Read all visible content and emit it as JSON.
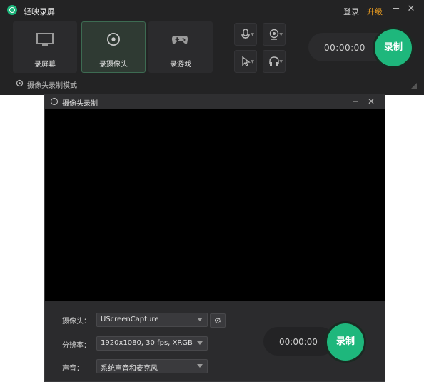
{
  "app": {
    "title": "轻映录屏",
    "login": "登录",
    "upgrade": "升级",
    "accent": "#1eb77c",
    "upgrade_color": "#f0a020"
  },
  "modes": [
    {
      "label": "录屏幕",
      "icon": "monitor-icon"
    },
    {
      "label": "录摄像头",
      "icon": "camera-lens-icon",
      "active": true
    },
    {
      "label": "录游戏",
      "icon": "gamepad-icon"
    }
  ],
  "tools": [
    "microphone-icon",
    "webcam-icon",
    "cursor-icon",
    "headphones-icon"
  ],
  "timer": "00:00:00",
  "record_label": "录制",
  "mode_info": "摄像头录制模式",
  "camera_window": {
    "title": "摄像头录制",
    "camera_label": "摄像头：",
    "camera_value": "UScreenCapture",
    "resolution_label": "分辨率：",
    "resolution_value": "1920x1080, 30 fps, XRGB",
    "audio_label": "声音：",
    "audio_value": "系统声音和麦克风",
    "timer": "00:00:00",
    "record_label": "录制"
  }
}
